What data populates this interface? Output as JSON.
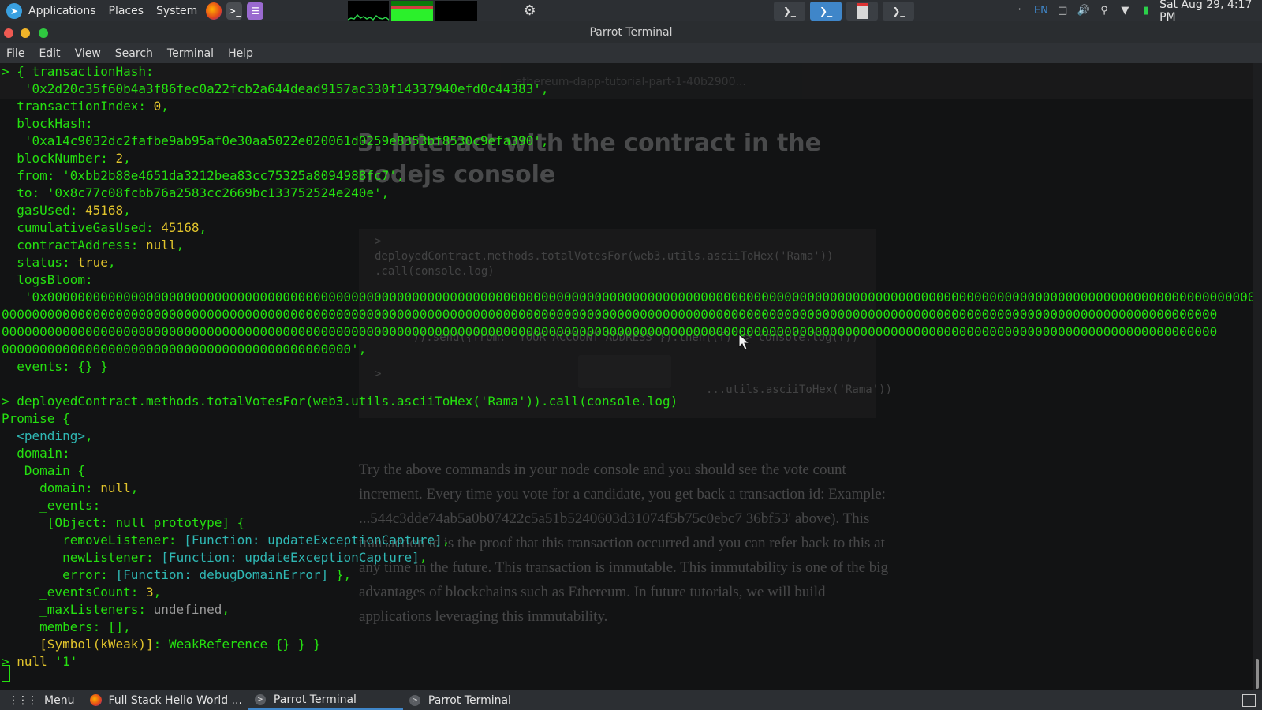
{
  "top_panel": {
    "applications": "Applications",
    "places": "Places",
    "system": "System",
    "keyboard_layout": "EN",
    "clock": "Sat Aug 29,  4:17 PM"
  },
  "window": {
    "title": "Parrot Terminal",
    "menu": [
      "File",
      "Edit",
      "View",
      "Search",
      "Terminal",
      "Help"
    ]
  },
  "terminal": {
    "lines": [
      [
        {
          "t": "> { transactionHash:",
          "c": "s"
        }
      ],
      [
        {
          "t": "   '0x2d20c35f60b4a3f86fec0a22fcb2a644dead9157ac330f14337940efd0c44383',",
          "c": "s"
        }
      ],
      [
        {
          "t": "  transactionIndex: ",
          "c": "s"
        },
        {
          "t": "0",
          "c": "y"
        },
        {
          "t": ",",
          "c": "s"
        }
      ],
      [
        {
          "t": "  blockHash:",
          "c": "s"
        }
      ],
      [
        {
          "t": "   '0xa14c9032dc2fafbe9ab95af0e30aa5022e020061d0259e8353bf8530c9efa390',",
          "c": "s"
        }
      ],
      [
        {
          "t": "  blockNumber: ",
          "c": "s"
        },
        {
          "t": "2",
          "c": "y"
        },
        {
          "t": ",",
          "c": "s"
        }
      ],
      [
        {
          "t": "  from: '0xbb2b88e4651da3212bea83cc75325a8094988fc7',",
          "c": "s"
        }
      ],
      [
        {
          "t": "  to: '0x8c77c08fcbb76a2583cc2669bc133752524e240e',",
          "c": "s"
        }
      ],
      [
        {
          "t": "  gasUsed: ",
          "c": "s"
        },
        {
          "t": "45168",
          "c": "y"
        },
        {
          "t": ",",
          "c": "s"
        }
      ],
      [
        {
          "t": "  cumulativeGasUsed: ",
          "c": "s"
        },
        {
          "t": "45168",
          "c": "y"
        },
        {
          "t": ",",
          "c": "s"
        }
      ],
      [
        {
          "t": "  contractAddress: ",
          "c": "s"
        },
        {
          "t": "null",
          "c": "y"
        },
        {
          "t": ",",
          "c": "s"
        }
      ],
      [
        {
          "t": "  status: ",
          "c": "s"
        },
        {
          "t": "true",
          "c": "y"
        },
        {
          "t": ",",
          "c": "s"
        }
      ],
      [
        {
          "t": "  logsBloom:",
          "c": "s"
        }
      ],
      [
        {
          "t": "   '0x0000000000000000000000000000000000000000000000000000000000000000000000000000000000000000000000000000000000000000000000000000000000000000000000000000000000000000",
          "c": "s"
        }
      ],
      [
        {
          "t": "0000000000000000000000000000000000000000000000000000000000000000000000000000000000000000000000000000000000000000000000000000000000000000000000000000000000000000",
          "c": "s"
        }
      ],
      [
        {
          "t": "0000000000000000000000000000000000000000000000000000000000000000000000000000000000000000000000000000000000000000000000000000000000000000000000000000000000000000",
          "c": "s"
        }
      ],
      [
        {
          "t": "0000000000000000000000000000000000000000000000',",
          "c": "s"
        }
      ],
      [
        {
          "t": "  events: {} }",
          "c": "s"
        }
      ],
      [
        {
          "t": "",
          "c": "s"
        }
      ],
      [
        {
          "t": "> deployedContract.methods.totalVotesFor(web3.utils.asciiToHex('Rama')).call(console.log)",
          "c": "s"
        }
      ],
      [
        {
          "t": "Promise {",
          "c": "s"
        }
      ],
      [
        {
          "t": "  ",
          "c": "s"
        },
        {
          "t": "<pending>",
          "c": "c"
        },
        {
          "t": ",",
          "c": "s"
        }
      ],
      [
        {
          "t": "  domain:",
          "c": "s"
        }
      ],
      [
        {
          "t": "   Domain {",
          "c": "s"
        }
      ],
      [
        {
          "t": "     domain: ",
          "c": "s"
        },
        {
          "t": "null",
          "c": "y"
        },
        {
          "t": ",",
          "c": "s"
        }
      ],
      [
        {
          "t": "     _events:",
          "c": "s"
        }
      ],
      [
        {
          "t": "      [Object: null prototype] {",
          "c": "s"
        }
      ],
      [
        {
          "t": "        removeListener: ",
          "c": "s"
        },
        {
          "t": "[Function: updateExceptionCapture]",
          "c": "c"
        },
        {
          "t": ",",
          "c": "s"
        }
      ],
      [
        {
          "t": "        newListener: ",
          "c": "s"
        },
        {
          "t": "[Function: updateExceptionCapture]",
          "c": "c"
        },
        {
          "t": ",",
          "c": "s"
        }
      ],
      [
        {
          "t": "        error: ",
          "c": "s"
        },
        {
          "t": "[Function: debugDomainError]",
          "c": "c"
        },
        {
          "t": " },",
          "c": "s"
        }
      ],
      [
        {
          "t": "     _eventsCount: ",
          "c": "s"
        },
        {
          "t": "3",
          "c": "y"
        },
        {
          "t": ",",
          "c": "s"
        }
      ],
      [
        {
          "t": "     _maxListeners: ",
          "c": "s"
        },
        {
          "t": "undefined",
          "c": "g"
        },
        {
          "t": ",",
          "c": "s"
        }
      ],
      [
        {
          "t": "     members: [],",
          "c": "s"
        }
      ],
      [
        {
          "t": "     ",
          "c": "s"
        },
        {
          "t": "[Symbol(kWeak)]",
          "c": "y"
        },
        {
          "t": ": WeakReference {} } }",
          "c": "s"
        }
      ],
      [
        {
          "t": "> ",
          "c": "s"
        },
        {
          "t": "null",
          "c": "y"
        },
        {
          "t": " '1'",
          "c": "s"
        }
      ]
    ]
  },
  "background_page": {
    "heading": "3. Interact with the contract in the nodejs console",
    "code_lines": [
      ">",
      "deployedContract.methods.totalVotesFor(web3.utils.asciiToHex('Rama'))",
      ".call(console.log)",
      "')).send({from: 'YOUR ACCOUNT ADDRESS'}).then((f) => console.log(f))",
      ">",
      "...utils.asciiToHex('Rama'))"
    ],
    "paragraph": "Try the above commands in your node console and you should see the vote count increment. Every time you vote for a candidate, you get back a transaction id: Example: ...544c3dde74ab5a0b07422c5a51b5240603d31074f5b75c0ebc7 36bf53' above). This transaction id is the proof that this transaction occurred and you can refer back to this at any time in the future. This transaction is immutable. This immutability is one of the big advantages of blockchains such as Ethereum. In future tutorials, we will build applications leveraging this immutability."
  },
  "taskbar": {
    "menu": "Menu",
    "items": [
      "Full Stack Hello World ...",
      "Parrot Terminal",
      "Parrot Terminal"
    ]
  },
  "colors": {
    "terminal_green": "#25e010",
    "terminal_yellow": "#e1c42c",
    "terminal_cyan": "#2fb8b4",
    "accent_blue": "#3f86c9"
  }
}
